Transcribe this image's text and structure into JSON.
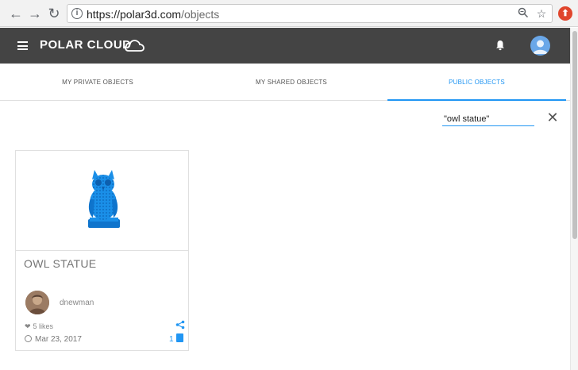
{
  "browser": {
    "url_host": "https://polar3d.com",
    "url_path": "/objects",
    "back_glyph": "←",
    "forward_glyph": "→",
    "reload_glyph": "↻"
  },
  "header": {
    "logo_text": "POLAR CLOUD"
  },
  "tabs": [
    {
      "label": "MY PRIVATE OBJECTS",
      "active": false
    },
    {
      "label": "MY SHARED OBJECTS",
      "active": false
    },
    {
      "label": "PUBLIC OBJECTS",
      "active": true
    }
  ],
  "search": {
    "value": "\"owl statue\""
  },
  "card": {
    "title": "OWL STATUE",
    "user": "dnewman",
    "likes": "5 likes",
    "date": "Mar 23, 2017",
    "file_count": "1"
  },
  "colors": {
    "accent": "#2196f3",
    "header_bg": "#444444",
    "model_blue": "#1a8fe8"
  }
}
